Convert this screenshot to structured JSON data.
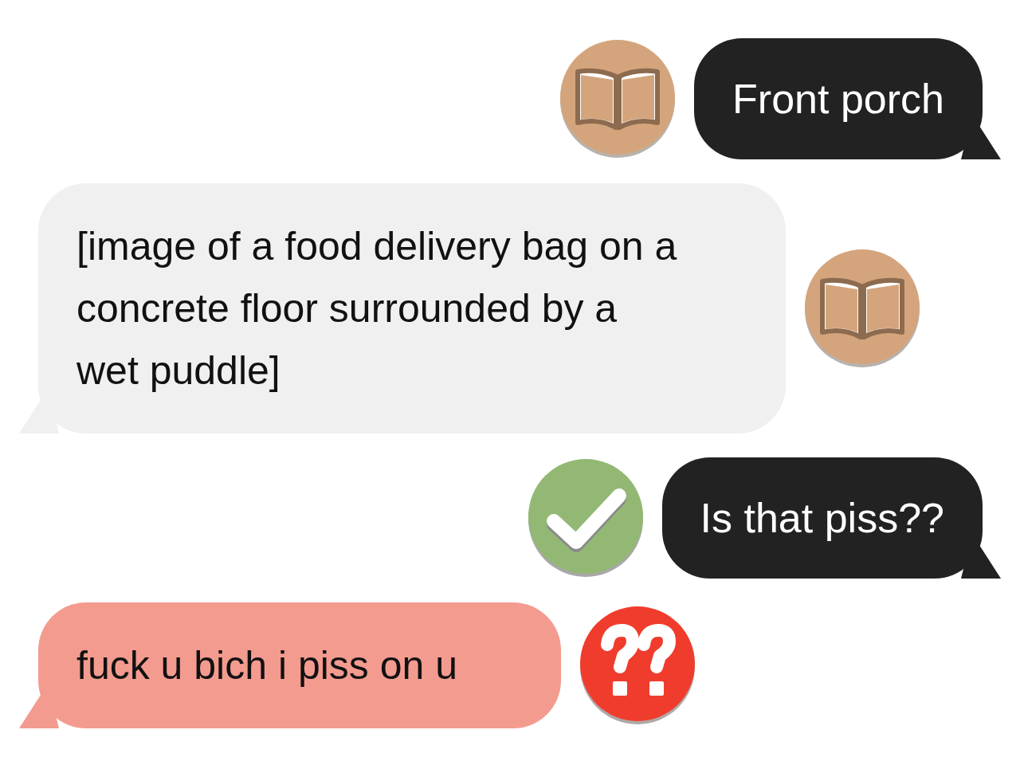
{
  "messages": [
    {
      "kind": "sent",
      "text": "Front porch",
      "color": "#222222",
      "reaction": {
        "kind": "book"
      }
    },
    {
      "kind": "received",
      "text": "[image of a food delivery bag on a concrete floor surrounded by a wet puddle]",
      "color": "#f0f0f0",
      "reaction": {
        "kind": "book"
      }
    },
    {
      "kind": "sent",
      "text": "Is that piss??",
      "color": "#222222",
      "reaction": {
        "kind": "check"
      }
    },
    {
      "kind": "received",
      "text": "fuck u bich i piss on u",
      "color": "#f49b8f",
      "reaction": {
        "kind": "question"
      }
    }
  ]
}
